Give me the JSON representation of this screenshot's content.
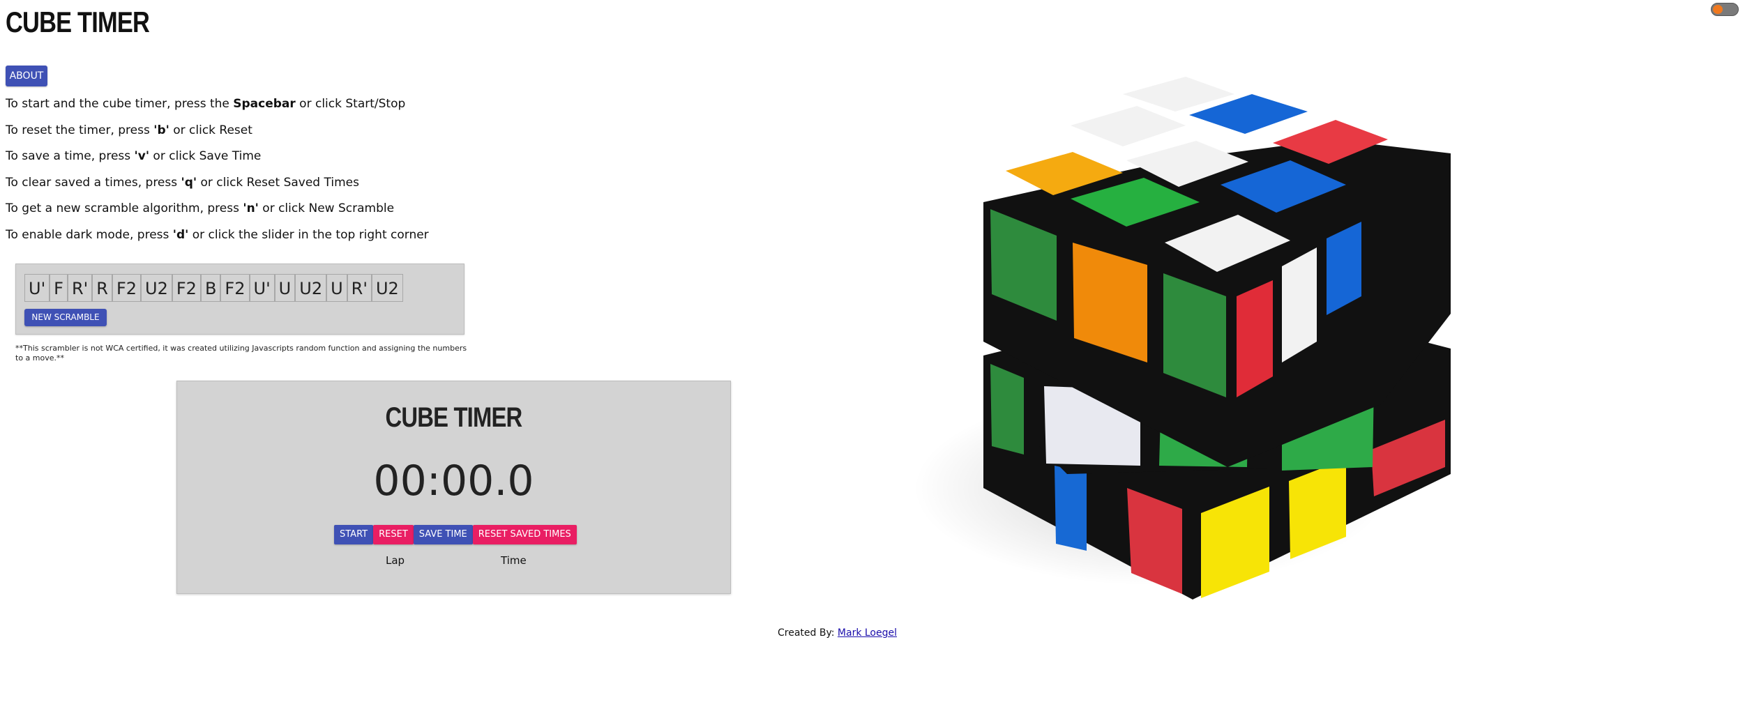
{
  "header": {
    "title": "CUBE TIMER"
  },
  "theme_toggle": {
    "accent_color": "#f0791f"
  },
  "about_button": {
    "label": "ABOUT"
  },
  "instructions": [
    {
      "before": "To start and the cube timer, press the ",
      "key": "Spacebar",
      "after": " or click Start/Stop"
    },
    {
      "before": "To reset the timer, press ",
      "key": "'b'",
      "after": " or click Reset"
    },
    {
      "before": "To save a time, press ",
      "key": "'v'",
      "after": " or click Save Time"
    },
    {
      "before": "To clear saved a times, press ",
      "key": "'q'",
      "after": " or click Reset Saved Times"
    },
    {
      "before": "To get a new scramble algorithm, press ",
      "key": "'n'",
      "after": " or click New Scramble"
    },
    {
      "before": "To enable dark mode, press ",
      "key": "'d'",
      "after": " or click the slider in the top right corner"
    }
  ],
  "scramble": {
    "moves": [
      "U'",
      "F",
      "R'",
      "R",
      "F2",
      "U2",
      "F2",
      "B",
      "F2",
      "U'",
      "U",
      "U2",
      "U",
      "R'",
      "U2"
    ],
    "new_scramble_label": "NEW SCRAMBLE",
    "disclaimer": "**This scrambler is not WCA certified, it was created utilizing Javascripts random function and assigning the numbers to a move.**"
  },
  "timer": {
    "title": "CUBE TIMER",
    "display": "00:00.0",
    "buttons": {
      "start": "START",
      "reset": "RESET",
      "save_time": "SAVE TIME",
      "reset_saved_times": "RESET SAVED TIMES"
    },
    "table": {
      "lap_header": "Lap",
      "time_header": "Time"
    }
  },
  "footer": {
    "prefix": "Created By: ",
    "author": "Mark Loegel"
  },
  "colors": {
    "button_primary": "#3f51b5",
    "button_secondary": "#e91e63",
    "panel_background": "#d3d3d3"
  }
}
